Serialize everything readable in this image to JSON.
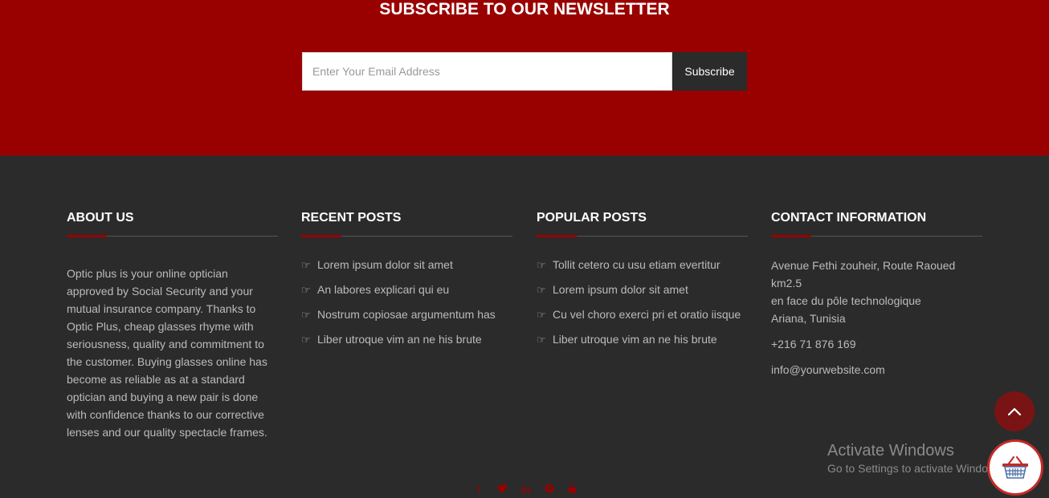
{
  "newsletter": {
    "title": "SUBSCRIBE TO OUR NEWSLETTER",
    "email_placeholder": "Enter Your Email Address",
    "email_value": "",
    "subscribe_label": "Subscribe"
  },
  "about": {
    "title": "ABOUT US",
    "text": "Optic plus is your online optician approved by Social Security and your mutual insurance company. Thanks to Optic Plus, cheap glasses rhyme with seriousness, quality and commitment to the customer. Buying glasses online has become as reliable as at a standard optician and buying a new pair is done with confidence thanks to our corrective lenses and our quality spectacle frames."
  },
  "recent_posts": {
    "title": "RECENT POSTS",
    "items": [
      "Lorem ipsum dolor sit amet",
      "An labores explicari qui eu",
      "Nostrum copiosae argumentum has",
      "Liber utroque vim an ne his brute"
    ]
  },
  "popular_posts": {
    "title": "POPULAR POSTS",
    "items": [
      "Tollit cetero cu usu etiam evertitur",
      "Lorem ipsum dolor sit amet",
      "Cu vel choro exerci pri et oratio iisque",
      "Liber utroque vim an ne his brute"
    ]
  },
  "contact": {
    "title": "CONTACT INFORMATION",
    "address_lines": [
      "Avenue Fethi zouheir, Route Raoued",
      "km2.5",
      "en face du pôle technologique",
      "Ariana, Tunisia"
    ],
    "phone": "+216 71 876 169",
    "email": "info@yourwebsite.com"
  },
  "social": {
    "icons": [
      "facebook-icon",
      "twitter-icon",
      "linkedin-icon",
      "pinterest-icon",
      "youtube-icon"
    ]
  },
  "watermark": {
    "title": "Activate Windows",
    "subtitle": "Go to Settings to activate Windows."
  },
  "colors": {
    "brand_red": "#990000",
    "footer_bg": "#2b2b2b",
    "button_dark": "#2b2b2b"
  }
}
